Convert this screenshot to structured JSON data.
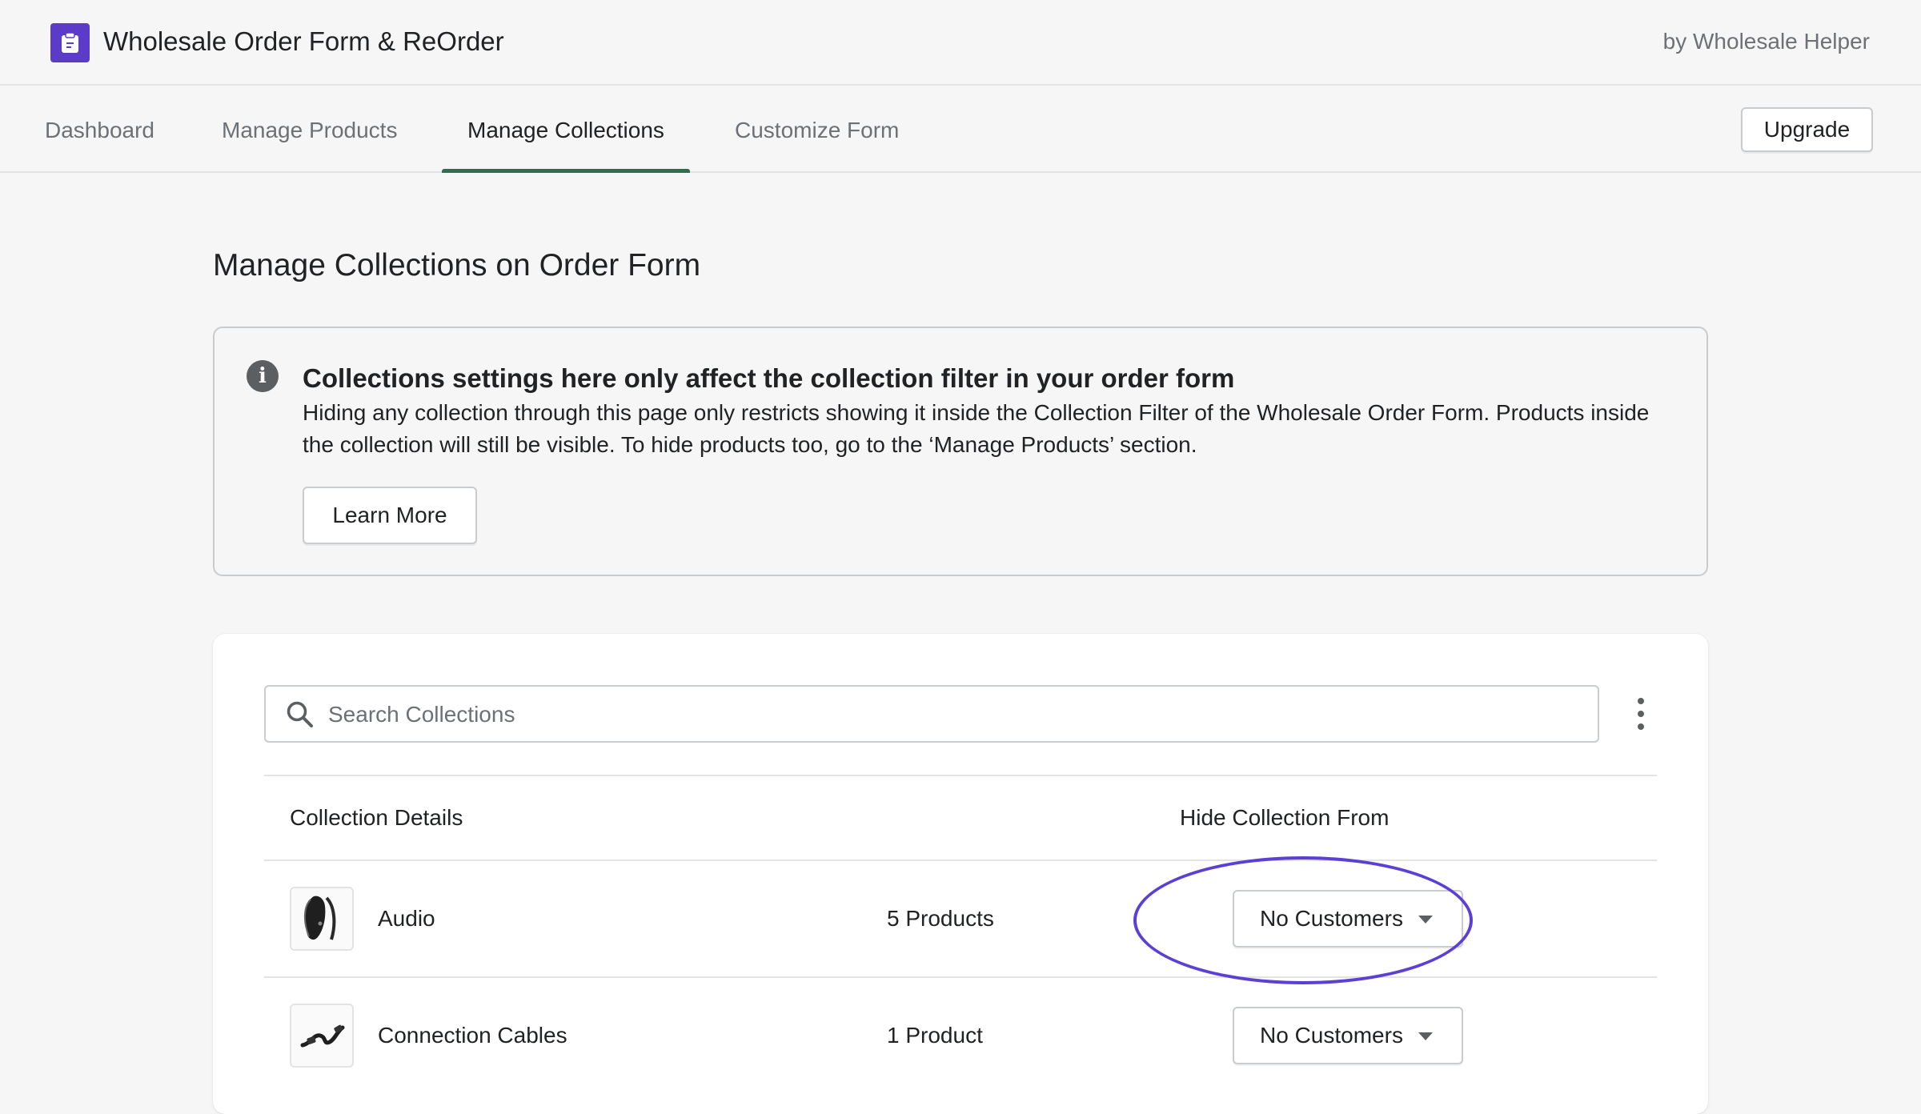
{
  "header": {
    "app_title": "Wholesale Order Form & ReOrder",
    "byline": "by Wholesale Helper",
    "logo_icon": "clipboard-icon",
    "logo_color": "#5c3bc9"
  },
  "nav": {
    "tabs": [
      {
        "label": "Dashboard",
        "active": false
      },
      {
        "label": "Manage Products",
        "active": false
      },
      {
        "label": "Manage Collections",
        "active": true
      },
      {
        "label": "Customize Form",
        "active": false
      }
    ],
    "upgrade_label": "Upgrade",
    "accent_color": "#2c6e4f"
  },
  "page": {
    "title": "Manage Collections on Order Form"
  },
  "banner": {
    "icon": "info-icon",
    "title": "Collections settings here only affect the collection filter in your order form",
    "body": "Hiding any collection through this page only restricts showing it inside the Collection Filter of the Wholesale Order Form. Products inside the collection will still be visible. To hide products too, go to the ‘Manage Products’ section.",
    "button_label": "Learn More"
  },
  "collections": {
    "search_placeholder": "Search Collections",
    "columns": {
      "details": "Collection Details",
      "hide_from": "Hide Collection From"
    },
    "rows": [
      {
        "name": "Audio",
        "count": "5 Products",
        "hide_from": "No Customers",
        "thumb_icon": "headphones-icon"
      },
      {
        "name": "Connection Cables",
        "count": "1 Product",
        "hide_from": "No Customers",
        "thumb_icon": "cable-icon"
      }
    ],
    "highlight_color": "#5b3fd6"
  }
}
